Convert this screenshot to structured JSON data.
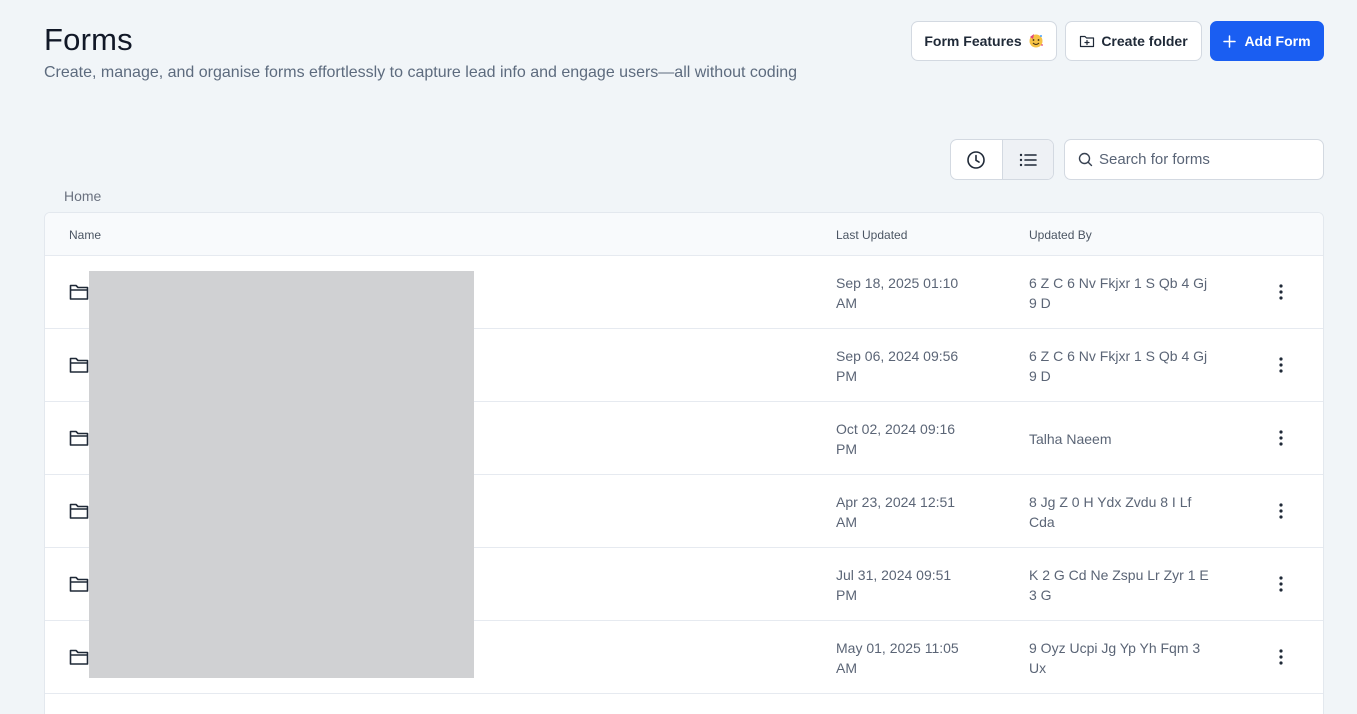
{
  "header": {
    "title": "Forms",
    "subtitle": "Create, manage, and organise forms effortlessly to capture lead info and engage users—all without coding",
    "buttons": {
      "features": "Form Features",
      "create_folder": "Create folder",
      "add_form": "Add Form"
    }
  },
  "toolbar": {
    "search_placeholder": "Search for forms",
    "active_view": "list"
  },
  "breadcrumb": "Home",
  "table": {
    "columns": {
      "name": "Name",
      "last_updated": "Last Updated",
      "updated_by": "Updated By"
    },
    "rows": [
      {
        "name": "",
        "last_updated_l1": "Sep 18, 2025 01:10",
        "last_updated_l2": "AM",
        "updated_by_l1": "6 Z C 6 Nv Fkjxr 1 S Qb 4 Gj",
        "updated_by_l2": "9 D"
      },
      {
        "name": "",
        "last_updated_l1": "Sep 06, 2024 09:56",
        "last_updated_l2": "PM",
        "updated_by_l1": "6 Z C 6 Nv Fkjxr 1 S Qb 4 Gj",
        "updated_by_l2": "9 D"
      },
      {
        "name": "",
        "last_updated_l1": "Oct 02, 2024 09:16",
        "last_updated_l2": "PM",
        "updated_by_l1": "Talha Naeem",
        "updated_by_l2": ""
      },
      {
        "name": "",
        "last_updated_l1": "Apr 23, 2024 12:51",
        "last_updated_l2": "AM",
        "updated_by_l1": "8 Jg Z 0 H Ydx Zvdu 8 I Lf",
        "updated_by_l2": "Cda"
      },
      {
        "name": "",
        "last_updated_l1": "Jul 31, 2024 09:51",
        "last_updated_l2": "PM",
        "updated_by_l1": "K 2 G Cd Ne Zspu Lr Zyr 1 E",
        "updated_by_l2": "3 G"
      },
      {
        "name": "",
        "last_updated_l1": "May 01, 2025 11:05",
        "last_updated_l2": "AM",
        "updated_by_l1": "9 Oyz Ucpi Jg Yp Yh Fqm 3",
        "updated_by_l2": "Ux"
      }
    ]
  },
  "colors": {
    "background": "#f1f5f8",
    "primary": "#1a5ef2",
    "redaction": "#d0d1d3"
  },
  "icons": [
    "party-emoji-icon",
    "folder-plus-icon",
    "plus-icon",
    "clock-icon",
    "list-icon",
    "search-icon",
    "folder-icon",
    "more-vertical-icon"
  ]
}
